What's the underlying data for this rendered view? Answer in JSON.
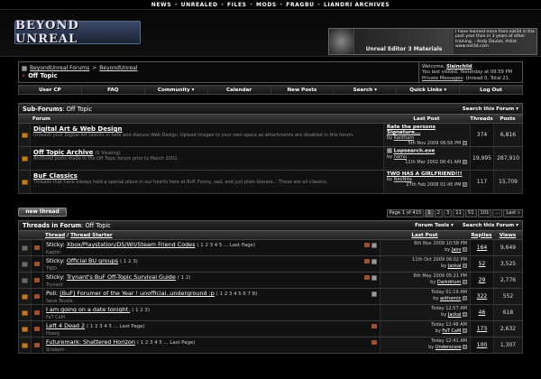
{
  "topnav": {
    "items": [
      "NEWS",
      "UNREALED",
      "FILES",
      "MODS",
      "FRAGBU",
      "LIANDRI ARCHIVES"
    ]
  },
  "header": {
    "logo_text": "BEYOND UNREAL",
    "banner_caption": "Unreal Editor 3 Materials",
    "banner_quote": "I have learned more from eat3d in the past year than in 3 years of other training. - Andy Davies, Artist",
    "banner_site": "www.eat3d.com"
  },
  "breadcrumb": {
    "root": "BeyondUnreal Forums",
    "parent": "BeyondUnreal",
    "current": "Off Topic"
  },
  "welcome": {
    "label": "Welcome,",
    "user": "Slainchild",
    "last_visit": "You last visited: Yesterday at 09:59 PM",
    "pm": "Private Messages",
    "pm_counts": ": Unread 0, Total 21."
  },
  "mainnav": [
    "User CP",
    "FAQ",
    "Community ▾",
    "Calendar",
    "New Posts",
    "Search ▾",
    "Quick Links ▾",
    "Log Out"
  ],
  "subforums": {
    "title": "Sub-Forums",
    "title_suffix": ": Off Topic",
    "search_label": "Search this Forum ▾",
    "col_forum": "Forum",
    "col_last": "Last Post",
    "col_threads": "Threads",
    "col_posts": "Posts",
    "rows": [
      {
        "title": "Digital Art & Web Design",
        "viewing": "",
        "desc": "Unleash your Digital Art talents in here and discuss Web Design. Upload images to your own space as attachments are disabled in this forum.",
        "last_title": "Rate the persons Signature...",
        "last_by_prefix": "by ",
        "last_by": "Kantham",
        "last_time": "5th Nov 2009 06:56 PM",
        "threads": "374",
        "posts": "6,816"
      },
      {
        "title": "Off Topic Archive",
        "viewing": "(9 Viewing)",
        "desc": "Archived posts made in the Off Topic forum prior to March 2002.",
        "last_title": "Lopsearch.exe",
        "last_by_prefix": "by ",
        "last_by": "namu",
        "last_time": "11th Mar 2002 08:41 AM",
        "threads": "19,995",
        "posts": "287,910"
      },
      {
        "title": "BuF Classics",
        "viewing": "",
        "desc": "Threads that have always held a special place in our hearts here at BuF. Funny, sad, and just plain bizzare... These are all classics.",
        "last_title": "TWO HAS A GIRLFRIEND!!!",
        "last_by_prefix": "by ",
        "last_by": "NeoNite",
        "last_time": "27th Feb 2008 01:45 PM",
        "threads": "117",
        "posts": "15,709"
      }
    ]
  },
  "newthread_label": "new thread",
  "pager": [
    "Page 1 of 415",
    "1",
    "2",
    "3",
    "11",
    "51",
    "101",
    "...",
    "Last »"
  ],
  "threads": {
    "title": "Threads in Forum",
    "title_suffix": ": Off Topic",
    "tools_label": "Forum Tools ▾",
    "search_label": "Search this Forum ▾",
    "col_thread": "Thread",
    "col_sep": " / ",
    "col_starter": "Thread Starter",
    "col_last": "Last Post",
    "col_replies": "Replies",
    "col_views": "Views",
    "rows": [
      {
        "prefix": "Sticky: ",
        "title": "Xbox/Playstation/DS/Wii/Steam Friend Codes",
        "pages": "( 1 2 3 4 5 ... Last Page)",
        "starter": "Kaptin",
        "last_time": "6th Nov 2009 10:58 PM",
        "last_by_prefix": "by ",
        "last_by": "Jaov",
        "replies": "164",
        "views": "9,649"
      },
      {
        "prefix": "Sticky: ",
        "title": "Official BU groups",
        "pages": "( 1 2 3)",
        "starter": "TWD",
        "last_time": "11th Oct 2009 06:02 PM",
        "last_by_prefix": "by ",
        "last_by": "Jackal",
        "replies": "52",
        "views": "3,525"
      },
      {
        "prefix": "Sticky: ",
        "title": "Trynant's BuF Off-Topic Survival Guide",
        "pages": "( 1 2)",
        "starter": "Trynant",
        "last_time": "6th May 2009 05:21 PM",
        "last_by_prefix": "by ",
        "last_by": "Darkdrium",
        "replies": "29",
        "views": "2,776"
      },
      {
        "prefix": "Poll: ",
        "title": "[BuF] Forumer of the Year ! unofficial..underground :p",
        "pages": "( 1 2 3 4 5 6 7 8)",
        "starter": "Seue Tecele",
        "last_time": "Today 01:19 AM",
        "last_by_prefix": "by ",
        "last_by": "anthemic",
        "replies": "322",
        "views": "552"
      },
      {
        "prefix": "",
        "title": "I am going on a date tonight.",
        "pages": "( 1 2 3)",
        "starter": "FaT CaM",
        "last_time": "Today 12:57 AM",
        "last_by_prefix": "by ",
        "last_by": "Jackal",
        "replies": "46",
        "views": "618"
      },
      {
        "prefix": "",
        "title": "Left 4 Dead 2",
        "pages": "( 1 2 3 4 5 ... Last Page)",
        "starter": "Hoerg",
        "last_time": "Today 12:48 AM",
        "last_by_prefix": "by ",
        "last_by": "FaT CaM",
        "replies": "173",
        "views": "2,632"
      },
      {
        "prefix": "",
        "title": "Futuremark: Shattered Horizon",
        "pages": "( 1 2 3 4 5 ... Last Page)",
        "starter": "Sindarin",
        "last_time": "Today 12:41 AM",
        "last_by_prefix": "by ",
        "last_by": "Underscore",
        "replies": "100",
        "views": "1,307"
      }
    ]
  }
}
